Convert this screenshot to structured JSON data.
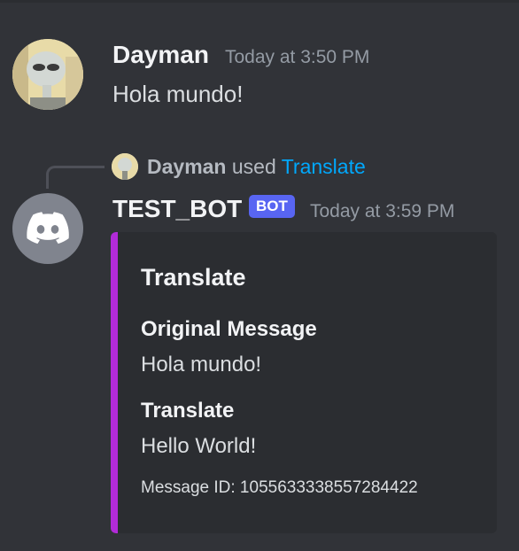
{
  "message1": {
    "author": "Dayman",
    "timestamp": "Today at 3:50 PM",
    "content": "Hola mundo!"
  },
  "reply": {
    "user": "Dayman",
    "used_text": "used",
    "command": "Translate"
  },
  "message2": {
    "author": "TEST_BOT",
    "bot_tag": "BOT",
    "timestamp": "Today at 3:59 PM"
  },
  "embed": {
    "color": "#b22bd8",
    "title": "Translate",
    "fields": [
      {
        "name": "Original Message",
        "value": "Hola mundo!"
      },
      {
        "name": "Translate",
        "value": "Hello World!"
      }
    ],
    "footer": "Message ID: 1055633338557284422"
  },
  "icons": {
    "user_avatar": "cartoon-alien-avatar",
    "bot_avatar": "discord-logo-icon"
  }
}
